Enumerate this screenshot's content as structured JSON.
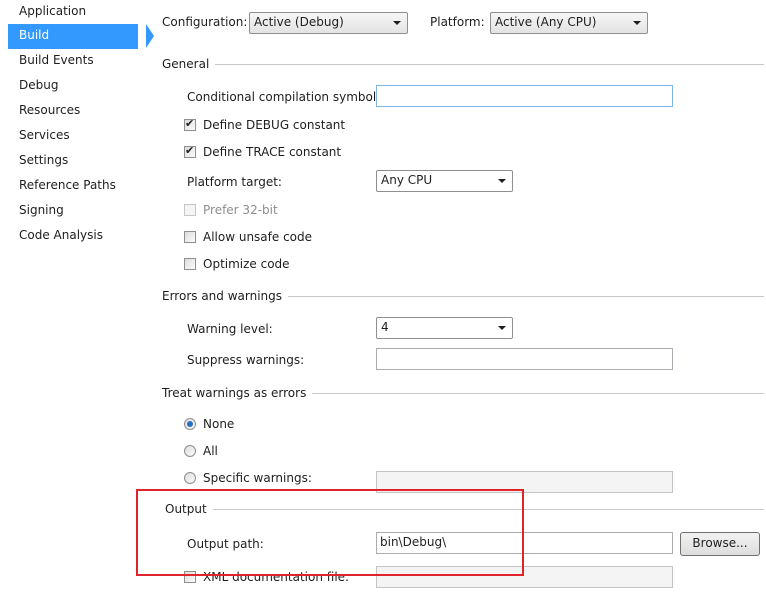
{
  "sidebar": {
    "items": [
      {
        "label": "Application"
      },
      {
        "label": "Build"
      },
      {
        "label": "Build Events"
      },
      {
        "label": "Debug"
      },
      {
        "label": "Resources"
      },
      {
        "label": "Services"
      },
      {
        "label": "Settings"
      },
      {
        "label": "Reference Paths"
      },
      {
        "label": "Signing"
      },
      {
        "label": "Code Analysis"
      }
    ],
    "selected": "Build"
  },
  "header": {
    "configuration_label": "Configuration:",
    "configuration_value": "Active (Debug)",
    "platform_label": "Platform:",
    "platform_value": "Active (Any CPU)"
  },
  "general": {
    "title": "General",
    "conditional_symbols_label": "Conditional compilation symbols:",
    "conditional_symbols_value": "",
    "define_debug_label": "Define DEBUG constant",
    "define_debug_checked": true,
    "define_trace_label": "Define TRACE constant",
    "define_trace_checked": true,
    "platform_target_label": "Platform target:",
    "platform_target_value": "Any CPU",
    "prefer32_label": "Prefer 32-bit",
    "prefer32_checked": false,
    "allow_unsafe_label": "Allow unsafe code",
    "allow_unsafe_checked": false,
    "optimize_label": "Optimize code",
    "optimize_checked": false
  },
  "errors": {
    "title": "Errors and warnings",
    "warning_level_label": "Warning level:",
    "warning_level_value": "4",
    "suppress_label": "Suppress warnings:",
    "suppress_value": ""
  },
  "treat_warnings": {
    "title": "Treat warnings as errors",
    "options": [
      {
        "label": "None",
        "selected": true
      },
      {
        "label": "All",
        "selected": false
      },
      {
        "label": "Specific warnings:",
        "selected": false
      }
    ],
    "specific_value": ""
  },
  "output": {
    "title": "Output",
    "output_path_label": "Output path:",
    "output_path_value": "bin\\Debug\\",
    "browse_label": "Browse...",
    "xml_doc_label": "XML documentation file:",
    "xml_doc_checked": false,
    "xml_doc_value": ""
  },
  "colors": {
    "selection": "#3399ff",
    "highlight_box": "#e0252a"
  }
}
